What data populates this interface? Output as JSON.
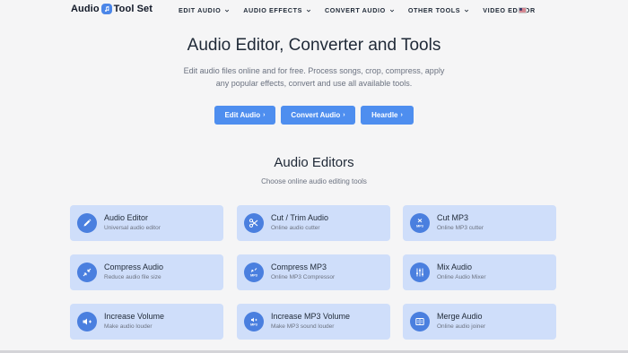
{
  "header": {
    "logo_left": "Audio",
    "logo_right": "Tool Set",
    "nav": [
      {
        "label": "EDIT AUDIO",
        "has_dropdown": true
      },
      {
        "label": "AUDIO EFFECTS",
        "has_dropdown": true
      },
      {
        "label": "CONVERT AUDIO",
        "has_dropdown": true
      },
      {
        "label": "OTHER TOOLS",
        "has_dropdown": true
      },
      {
        "label": "VIDEO EDITOR",
        "has_dropdown": false
      }
    ],
    "language_icon": "us-flag-icon"
  },
  "hero": {
    "title": "Audio Editor, Converter and Tools",
    "subtitle": "Edit audio files online and for free. Process songs, crop, compress, apply any popular effects, convert and use all available tools.",
    "buttons": [
      {
        "label": "Edit Audio",
        "arrow": "›"
      },
      {
        "label": "Convert Audio",
        "arrow": "›"
      },
      {
        "label": "Heardle",
        "arrow": "›"
      }
    ]
  },
  "section": {
    "title": "Audio Editors",
    "subtitle": "Choose online audio editing tools"
  },
  "tools": [
    {
      "title": "Audio Editor",
      "desc": "Universal audio editor",
      "icon": "pencil-icon"
    },
    {
      "title": "Cut / Trim Audio",
      "desc": "Online audio cutter",
      "icon": "scissors-icon"
    },
    {
      "title": "Cut MP3",
      "desc": "Online MP3 cutter",
      "icon": "cut-mp3-icon",
      "badge": "MP3"
    },
    {
      "title": "Compress Audio",
      "desc": "Reduce audio file size",
      "icon": "compress-icon"
    },
    {
      "title": "Compress MP3",
      "desc": "Online MP3 Compressor",
      "icon": "compress-mp3-icon",
      "badge": "MP3"
    },
    {
      "title": "Mix Audio",
      "desc": "Online Audio Mixer",
      "icon": "mixer-icon"
    },
    {
      "title": "Increase Volume",
      "desc": "Make audio louder",
      "icon": "volume-up-icon"
    },
    {
      "title": "Increase MP3 Volume",
      "desc": "Make MP3 sound louder",
      "icon": "mp3-volume-icon",
      "badge": "MP3"
    },
    {
      "title": "Merge Audio",
      "desc": "Online audio joiner",
      "icon": "merge-icon"
    }
  ],
  "colors": {
    "accent": "#4e8eef",
    "card_bg": "#cfdefa",
    "icon_bg": "#4a7fdf",
    "page_bg": "#f5f5f6"
  }
}
